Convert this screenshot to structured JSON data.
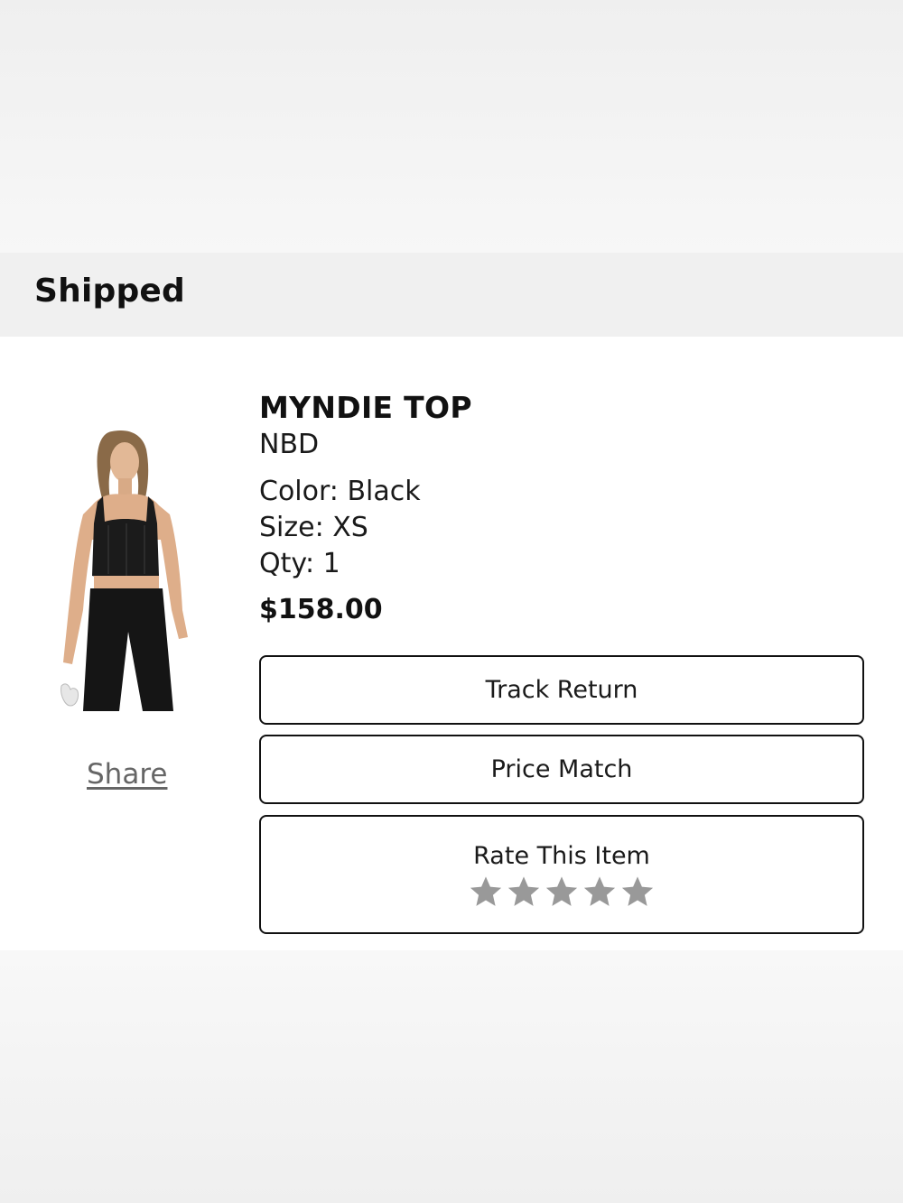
{
  "status": {
    "title": "Shipped"
  },
  "product": {
    "name": "MYNDIE TOP",
    "brand": "NBD",
    "color": "Color: Black",
    "size": "Size: XS",
    "qty": "Qty: 1",
    "price": "$158.00",
    "image_icon": "product-photo"
  },
  "share": {
    "label": "Share"
  },
  "actions": {
    "track_return": "Track Return",
    "price_match": "Price Match",
    "rate_item": "Rate This Item"
  },
  "rating": {
    "max": 5,
    "value": 0,
    "star_color": "#999999"
  },
  "colors": {
    "status_bar_bg": "#f0f0f0",
    "text": "#111111",
    "share_text": "#666666",
    "button_border": "#111111"
  }
}
